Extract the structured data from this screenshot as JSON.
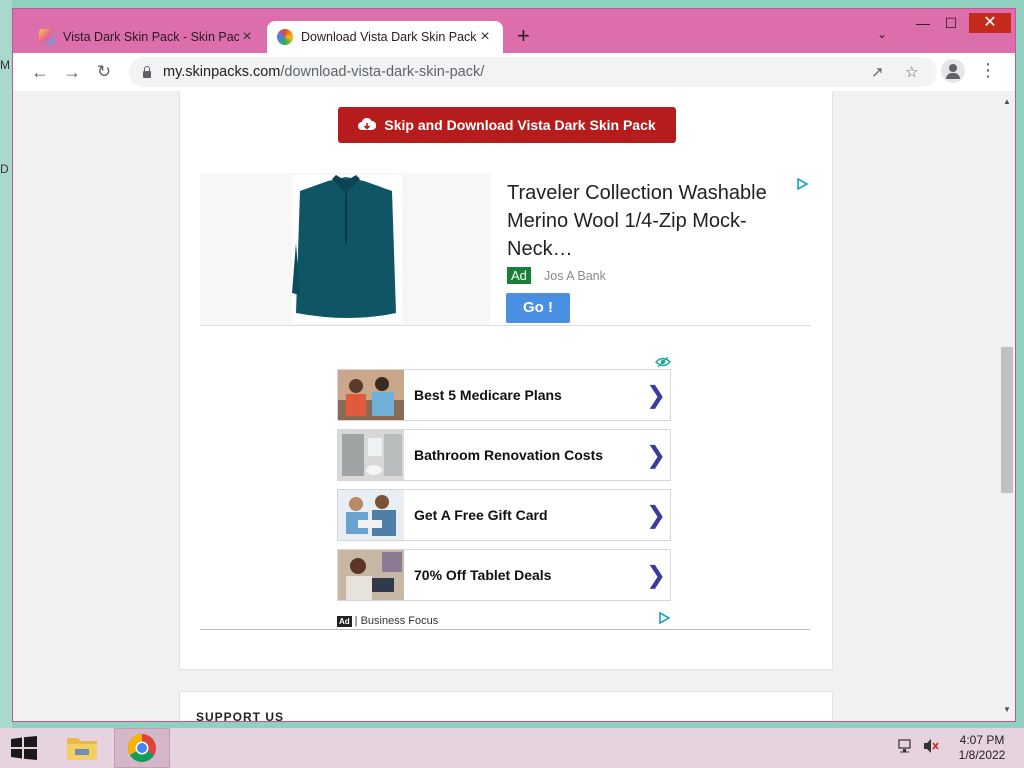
{
  "browser": {
    "tabs": [
      {
        "title": "Vista Dark Skin Pack - Skin Pack",
        "active": false
      },
      {
        "title": "Download Vista Dark Skin Pack -",
        "active": true
      }
    ],
    "new_tab_label": "+",
    "url_host": "my.skinpacks.com",
    "url_path": "/download-vista-dark-skin-pack/",
    "frame_color": "#dc6fab"
  },
  "page": {
    "download_button_label": "Skip and Download Vista Dark Skin Pack",
    "ad1": {
      "title": "Traveler Collection Washable Merino Wool 1/4-Zip Mock-Neck…",
      "badge": "Ad",
      "advertiser": "Jos A Bank",
      "cta": "Go !"
    },
    "ad2": {
      "items": [
        {
          "label": "Best 5 Medicare Plans"
        },
        {
          "label": "Bathroom Renovation Costs"
        },
        {
          "label": "Get A Free Gift Card"
        },
        {
          "label": "70% Off Tablet Deals"
        }
      ],
      "footer_mark": "Ad",
      "footer_text": "| Business Focus"
    },
    "next_section_label": "SUPPORT US"
  },
  "taskbar": {
    "time": "4:07 PM",
    "date": "1/8/2022"
  },
  "icons": {
    "chevron": "chevron-right-icon",
    "download": "cloud-download-icon"
  }
}
